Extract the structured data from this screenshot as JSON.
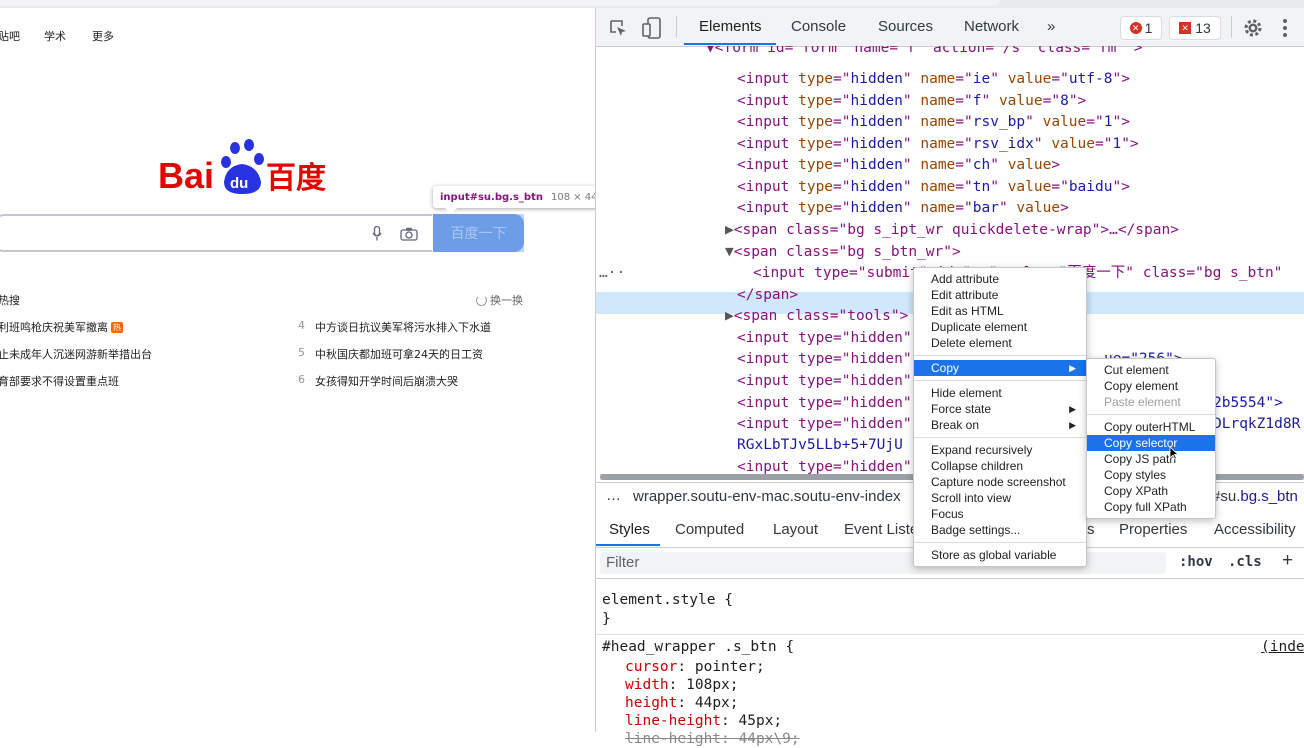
{
  "page": {
    "nav": [
      "贴吧",
      "学术",
      "更多"
    ],
    "search_button": "百度一下",
    "inspect_tooltip": {
      "selector": "input#su.bg.s_btn",
      "dims": "108 × 44"
    },
    "hot": {
      "title": "热搜",
      "refresh": "换一换",
      "items": [
        {
          "num": "",
          "text": "利班鸣枪庆祝美军撤离",
          "badge": "热"
        },
        {
          "num": "",
          "text": "止未成年人沉迷网游新举措出台",
          "badge": ""
        },
        {
          "num": "",
          "text": "育部要求不得设置重点班",
          "badge": ""
        },
        {
          "num": "4",
          "text": "中方谈日抗议美军将污水排入下水道",
          "badge": ""
        },
        {
          "num": "5",
          "text": "中秋国庆都加班可拿24天的日工资",
          "badge": ""
        },
        {
          "num": "6",
          "text": "女孩得知开学时间后崩溃大哭",
          "badge": ""
        }
      ]
    }
  },
  "devtools": {
    "tabs": [
      "Elements",
      "Console",
      "Sources",
      "Network",
      "»"
    ],
    "error_count": "1",
    "warning_count": "13",
    "breadcrumb_left": "wrapper.soutu-env-mac.soutu-env-index",
    "breadcrumb_right_hash": "#su",
    "breadcrumb_right_cls": ".bg.s_btn",
    "breadcrumb_ellipsis": "…",
    "subtabs": [
      "Styles",
      "Computed",
      "Layout",
      "Event Liste",
      "s",
      "Properties",
      "Accessibility"
    ],
    "filter_placeholder": "Filter",
    "hov": ":hov",
    "cls": ".cls",
    "plus": "+",
    "styles": {
      "element_style": "element.style {",
      "close1": "}",
      "rule_selector": "#head_wrapper .s_btn {",
      "rule_source": "(inde",
      "props": [
        {
          "name": "cursor",
          "value": "pointer;"
        },
        {
          "name": "width",
          "value": "108px;"
        },
        {
          "name": "height",
          "value": "44px;"
        },
        {
          "name": "line-height",
          "value": "45px;"
        }
      ],
      "struck": "line-height: 44px\\9;"
    },
    "code": {
      "form_line": "▼<form id=\"form\" name=\"f\" action=\"/s\" class=\"fm \">",
      "hidden_inputs": [
        {
          "name": "ie",
          "value": "utf-8"
        },
        {
          "name": "f",
          "value": "8"
        },
        {
          "name": "rsv_bp",
          "value": "1"
        },
        {
          "name": "rsv_idx",
          "value": "1"
        },
        {
          "name": "ch",
          "value": ""
        },
        {
          "name": "tn",
          "value": "baidu"
        },
        {
          "name": "bar",
          "value": ""
        }
      ],
      "span_ipt": "<span class=\"bg s_ipt_wr quickdelete-wrap\">…</span>",
      "span_btn": "<span class=\"bg s_btn_wr\">",
      "selected_line": "<input type=\"submit\" id=\"su\" value=\"百度一下\" class=\"bg s_btn\"",
      "span_close": "</span>",
      "span_tools": "<span class=\"tools\">",
      "partial": [
        "<input type=\"hidden\"",
        "<input type=\"hidden\"",
        "<input type=\"hidden\"",
        "<input type=\"hidden\"",
        "<input type=\"hidden\"",
        "<input type=\"hidden\""
      ],
      "frag_256": "ue=\"256\">",
      "frag_2b": "2b5554\">",
      "frag_dl": "DLrqkZ1d8R",
      "wrap_line": "RGxLbTJv5LLb+5+7UjU",
      "ellipsis_left": "…"
    }
  },
  "context_menu": {
    "items": [
      "Add attribute",
      "Edit attribute",
      "Edit as HTML",
      "Duplicate element",
      "Delete element"
    ],
    "copy": "Copy",
    "items2": [
      "Hide element",
      "Force state",
      "Break on"
    ],
    "items3": [
      "Expand recursively",
      "Collapse children",
      "Capture node screenshot",
      "Scroll into view",
      "Focus",
      "Badge settings..."
    ],
    "items4": [
      "Store as global variable"
    ]
  },
  "copy_submenu": {
    "items": [
      "Cut element",
      "Copy element",
      "Paste element",
      "Copy outerHTML",
      "Copy selector",
      "Copy JS path",
      "Copy styles",
      "Copy XPath",
      "Copy full XPath"
    ],
    "highlighted": "Copy selector"
  },
  "colors": {
    "accent": "#1a73e8",
    "baidu_blue": "#2932e1",
    "baidu_red": "#e10602",
    "search_button": "#6e94f3"
  }
}
